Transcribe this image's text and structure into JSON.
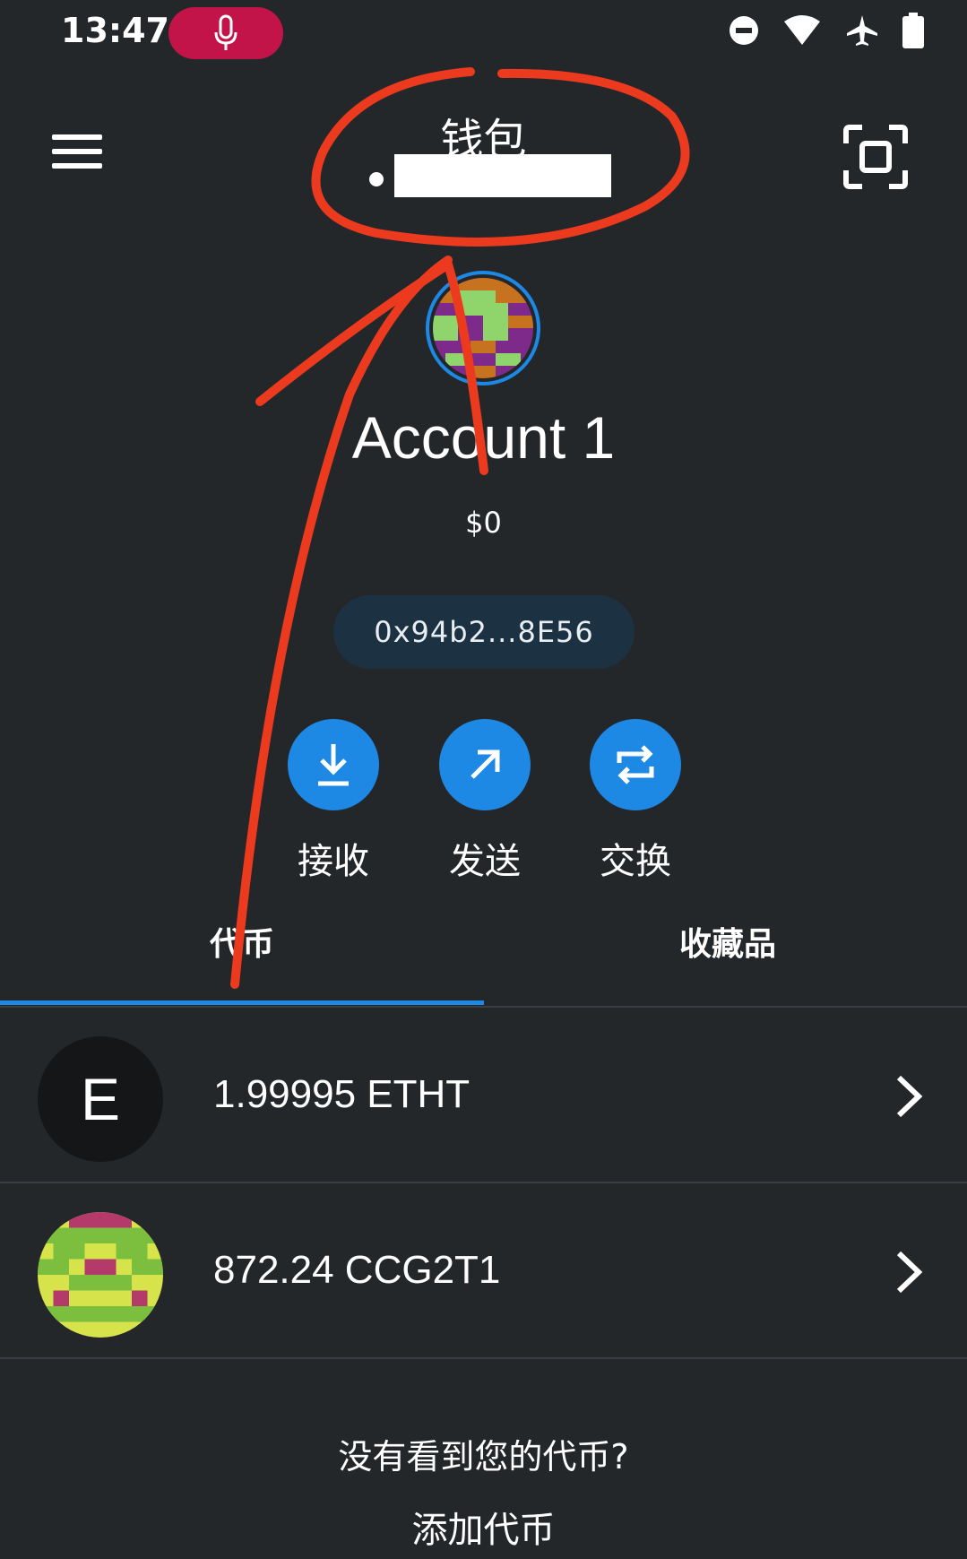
{
  "status_bar": {
    "time": "13:47",
    "icons": [
      "mic-icon",
      "do-not-disturb-icon",
      "wifi-icon",
      "airplane-icon",
      "battery-icon"
    ]
  },
  "header": {
    "title": "钱包",
    "menu_icon": "hamburger-menu-icon",
    "scan_icon": "scan-icon"
  },
  "account": {
    "name": "Account 1",
    "balance": "$0",
    "address": "0x94b2...8E56"
  },
  "actions": [
    {
      "label": "接收",
      "icon": "receive-icon"
    },
    {
      "label": "发送",
      "icon": "send-icon"
    },
    {
      "label": "交换",
      "icon": "swap-icon"
    }
  ],
  "tabs": [
    {
      "label": "代币",
      "active": true
    },
    {
      "label": "收藏品",
      "active": false
    }
  ],
  "tokens": [
    {
      "icon_letter": "E",
      "amount": "1.99995 ETHT"
    },
    {
      "amount": "872.24 CCG2T1"
    }
  ],
  "footer": {
    "question": "没有看到您的代币?",
    "link": "添加代币"
  },
  "colors": {
    "background": "#24272a",
    "accent": "#1e88e5",
    "mic_pill": "#c3144a",
    "annotation": "#ec3a1f"
  }
}
